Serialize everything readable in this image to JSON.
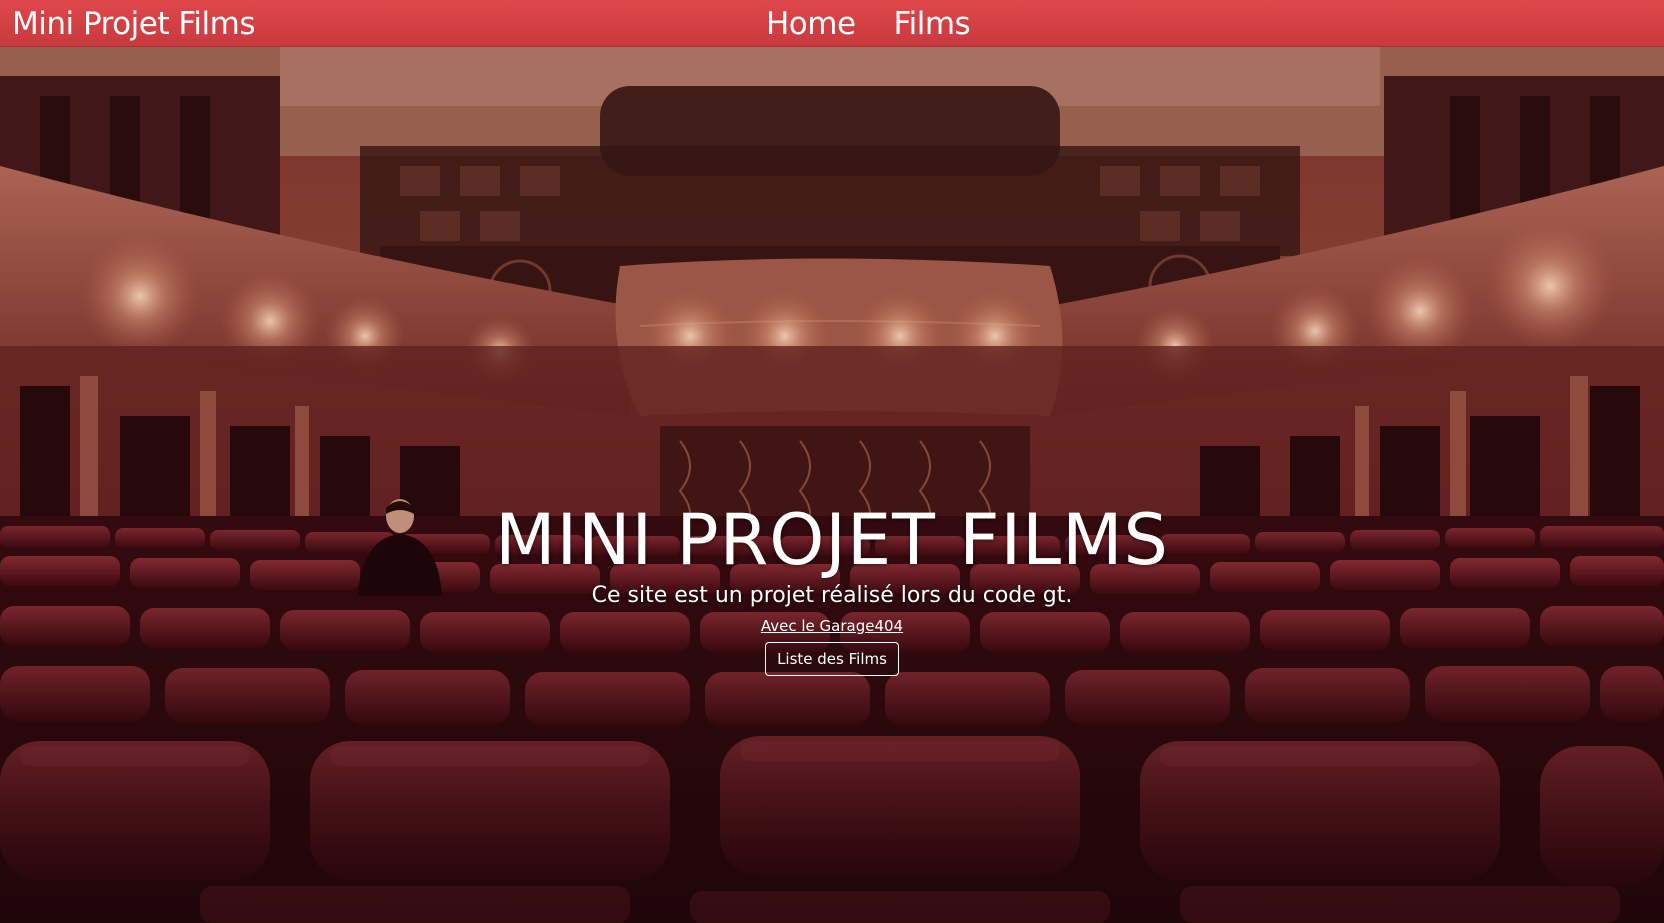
{
  "navbar": {
    "brand": "Mini Projet Films",
    "links": [
      {
        "label": "Home"
      },
      {
        "label": "Films"
      }
    ],
    "color": "#d94145"
  },
  "hero": {
    "title": "MINI PROJET FILMS",
    "subtitle": "Ce site est un projet réalisé lors du code gt.",
    "link_label": "Avec le Garage404",
    "button_label": "Liste des Films",
    "background": "theater-auditorium-photo"
  }
}
